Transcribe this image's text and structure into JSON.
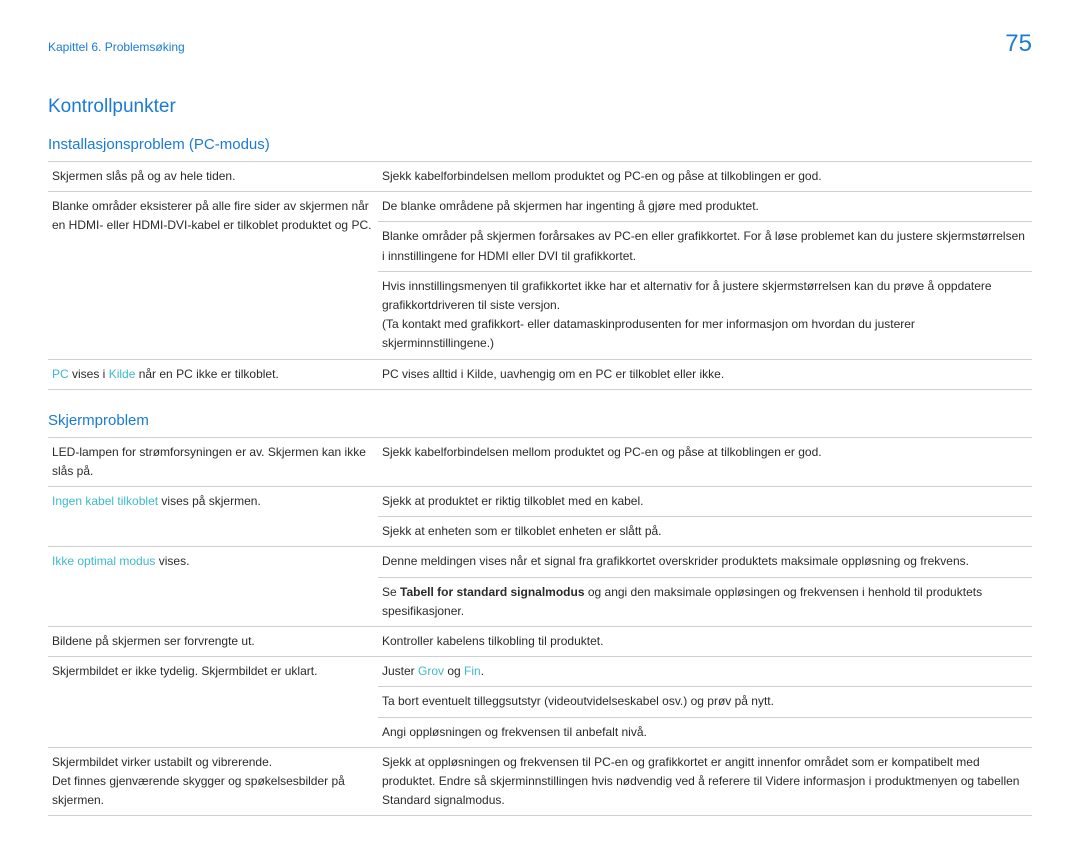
{
  "header": {
    "chapter": "Kapittel 6. Problemsøking",
    "page_number": "75"
  },
  "section_title": "Kontrollpunkter",
  "tables": [
    {
      "heading": "Installasjonsproblem (PC-modus)",
      "rows": [
        {
          "left_html": "Skjermen slås på og av hele tiden.",
          "right_html": "Sjekk kabelforbindelsen mellom produktet og PC-en og påse at tilkoblingen er god.",
          "left_rowspan": 1
        },
        {
          "left_html": "Blanke områder eksisterer på alle fire sider av skjermen når en HDMI- eller HDMI-DVI-kabel er tilkoblet produktet og PC.",
          "right_html": "De blanke områdene på skjermen har ingenting å gjøre med produktet.",
          "left_rowspan": 3
        },
        {
          "right_html": "Blanke områder på skjermen forårsakes av PC-en eller grafikkortet. For å løse problemet kan du justere skjermstørrelsen i innstillingene for HDMI eller DVI til grafikkortet."
        },
        {
          "right_html": "Hvis innstillingsmenyen til grafikkortet ikke har et alternativ for å justere skjermstørrelsen kan du prøve å oppdatere grafikkortdriveren til siste versjon.<br>(Ta kontakt med grafikkort- eller datamaskinprodusenten for mer informasjon om hvordan du justerer skjerminnstillingene.)"
        },
        {
          "left_html": "<span class=\"cyan\">PC</span> vises i <span class=\"cyan\">Kilde</span> når en PC ikke er tilkoblet.",
          "right_html": "PC vises alltid i Kilde, uavhengig om en PC er tilkoblet eller ikke.",
          "left_rowspan": 1
        }
      ]
    },
    {
      "heading": "Skjermproblem",
      "rows": [
        {
          "left_html": "LED-lampen for strømforsyningen er av. Skjermen kan ikke slås på.",
          "right_html": "Sjekk kabelforbindelsen mellom produktet og PC-en og påse at tilkoblingen er god.",
          "left_rowspan": 1
        },
        {
          "left_html": "<span class=\"cyan\">Ingen kabel tilkoblet</span> vises på skjermen.",
          "right_html": "Sjekk at produktet er riktig tilkoblet med en kabel.",
          "left_rowspan": 2
        },
        {
          "right_html": "Sjekk at enheten som er tilkoblet enheten er slått på."
        },
        {
          "left_html": "<span class=\"cyan\">Ikke optimal modus</span> vises.",
          "right_html": "Denne meldingen vises når et signal fra grafikkortet overskrider produktets maksimale oppløsning og frekvens.",
          "left_rowspan": 2
        },
        {
          "right_html": "Se <span class=\"bold\">Tabell for standard signalmodus</span> og angi den maksimale oppløsingen og frekvensen i henhold til produktets spesifikasjoner."
        },
        {
          "left_html": "Bildene på skjermen ser forvrengte ut.",
          "right_html": "Kontroller kabelens tilkobling til produktet.",
          "left_rowspan": 1
        },
        {
          "left_html": "Skjermbildet er ikke tydelig. Skjermbildet er uklart.",
          "right_html": "Juster <span class=\"cyan\">Grov</span> og <span class=\"cyan\">Fin</span>.",
          "left_rowspan": 3
        },
        {
          "right_html": "Ta bort eventuelt tilleggsutstyr (videoutvidelseskabel osv.) og prøv på nytt."
        },
        {
          "right_html": "Angi oppløsningen og frekvensen til anbefalt nivå."
        },
        {
          "left_html": "Skjermbildet virker ustabilt og vibrerende.<br>Det finnes gjenværende skygger og spøkelsesbilder på skjermen.",
          "right_html": "Sjekk at oppløsningen og frekvensen til PC-en og grafikkortet er angitt innenfor området som er kompatibelt med produktet. Endre så skjerminnstillingen hvis nødvendig ved å referere til Videre informasjon i produktmenyen og tabellen Standard signalmodus.",
          "left_rowspan": 1
        }
      ]
    }
  ]
}
